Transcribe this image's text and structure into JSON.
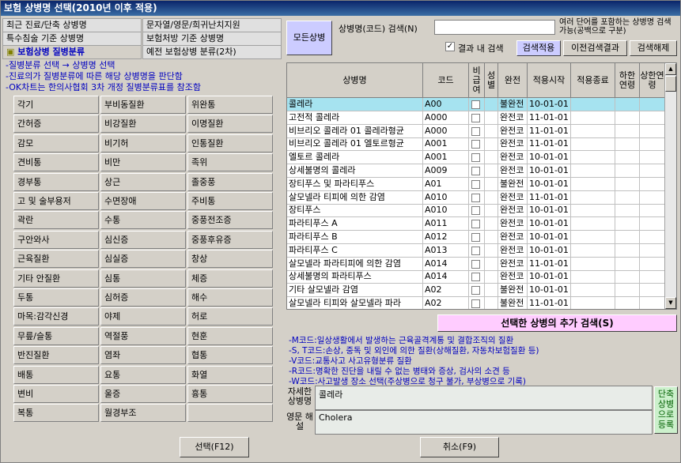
{
  "window_title": "보험 상병명 선택(2010년 이후 적용)",
  "tabs": [
    {
      "label": "최근 진료/단축 상병명"
    },
    {
      "label": "문자열/영문/희귀난치지원"
    },
    {
      "label": "특수침술 기준 상병명"
    },
    {
      "label": "보험처방 기준 상병명"
    },
    {
      "label": "보험상병 질병분류"
    },
    {
      "label": "예전 보험상병 분류(2차)"
    }
  ],
  "info_lines": [
    "-질병분류 선택 → 상병명 선택",
    "-진료의가 질병분류에 따른 해당 상병명을 판단함",
    "-OK차트는 한의사협회 3차 개정 질병분류표를 참조함"
  ],
  "categories": [
    "각기",
    "부비동질환",
    "위완통",
    "간허증",
    "비강질환",
    "이명질환",
    "감모",
    "비기허",
    "인통질환",
    "견비통",
    "비만",
    "족위",
    "경부통",
    "상근",
    "졸중풍",
    "고 및 술부용저",
    "수면장애",
    "주비통",
    "곽란",
    "수통",
    "중풍전조증",
    "구안와사",
    "심신증",
    "중풍후유증",
    "근육질환",
    "심실증",
    "창상",
    "기타 안질환",
    "심통",
    "체증",
    "두통",
    "심허증",
    "해수",
    "마목:감각신경",
    "야제",
    "허로",
    "무릎/슬통",
    "역절풍",
    "현훈",
    "반진질환",
    "염좌",
    "협통",
    "배통",
    "요통",
    "화열",
    "변비",
    "울증",
    "흉통",
    "복통",
    "월경부조",
    ""
  ],
  "top_right": {
    "all_button": "모든상병",
    "search_label": "상병명(코드) 검색(N)",
    "search_value": "",
    "search_hint": "여러 단어를 포함하는 상병명 검색 가능(공백으로 구분)",
    "in_result_label": "결과 내 검색",
    "in_result_checked": true,
    "apply_button": "검색적용",
    "prev_button": "이전검색결과",
    "clear_button": "검색해제"
  },
  "table": {
    "headers": [
      "상병명",
      "코드",
      "비급여",
      "성별",
      "완전",
      "적용시작",
      "적용종료",
      "하한연령",
      "상한연령"
    ],
    "rows": [
      {
        "name": "콜레라",
        "code": "A00",
        "complete": "불완전",
        "start": "10-01-01"
      },
      {
        "name": "고전적 콜레라",
        "code": "A000",
        "complete": "완전코",
        "start": "11-01-01"
      },
      {
        "name": "비브리오 콜레라 01 콜레라형균",
        "code": "A000",
        "complete": "완전코",
        "start": "11-01-01"
      },
      {
        "name": "비브리오 콜레라 01 엘토르형균",
        "code": "A001",
        "complete": "완전코",
        "start": "11-01-01"
      },
      {
        "name": "엘토르 콜레라",
        "code": "A001",
        "complete": "완전코",
        "start": "10-01-01"
      },
      {
        "name": "상세불명의 콜레라",
        "code": "A009",
        "complete": "완전코",
        "start": "10-01-01"
      },
      {
        "name": "장티푸스 및 파라티푸스",
        "code": "A01",
        "complete": "불완전",
        "start": "10-01-01"
      },
      {
        "name": "살모넬라 티피에 의한 감염",
        "code": "A010",
        "complete": "완전코",
        "start": "11-01-01"
      },
      {
        "name": "장티푸스",
        "code": "A010",
        "complete": "완전코",
        "start": "10-01-01"
      },
      {
        "name": "파라티푸스 A",
        "code": "A011",
        "complete": "완전코",
        "start": "10-01-01"
      },
      {
        "name": "파라티푸스 B",
        "code": "A012",
        "complete": "완전코",
        "start": "10-01-01"
      },
      {
        "name": "파라티푸스 C",
        "code": "A013",
        "complete": "완전코",
        "start": "10-01-01"
      },
      {
        "name": "살모넬라 파라티피에 의한 감염",
        "code": "A014",
        "complete": "완전코",
        "start": "11-01-01"
      },
      {
        "name": "상세불명의 파라티푸스",
        "code": "A014",
        "complete": "완전코",
        "start": "10-01-01"
      },
      {
        "name": "기타 살모넬라 감염",
        "code": "A02",
        "complete": "불완전",
        "start": "10-01-01"
      },
      {
        "name": "살모넬라 티피와 살모넬라 파라",
        "code": "A02",
        "complete": "불완전",
        "start": "11-01-01"
      }
    ]
  },
  "extra_search_button": "선택한 상병의 추가 검색(S)",
  "notes": [
    "-M코드:일상생활에서 발생하는 근육골격계통 및 결합조직의 질환",
    "-S, T코드:손상, 중독 및 외인에 의한 질환(상해질환, 자동차보험질환 등)",
    "-V코드:교통사고 사고유형분류 질환",
    "-R코드:명확한 진단을 내릴 수 없는 병태와 증상, 검사의 소견 등",
    "-W코드:사고발생 장소 선택(주상병으로 청구 불가, 부상병으로 기록)"
  ],
  "detail": {
    "kor_label": "자세한 상병명",
    "kor_value": "콜레라",
    "eng_label": "영문 해설",
    "eng_value": "Cholera",
    "register_button": "단축상병으로 등록"
  },
  "bottom": {
    "select_button": "선택(F12)",
    "cancel_button": "취소(F9)"
  },
  "colors": {
    "accent_button": "#ccccff",
    "pink_button": "#ffccff",
    "selected_row": "#a6e3f0",
    "info_text": "#0000c0"
  }
}
